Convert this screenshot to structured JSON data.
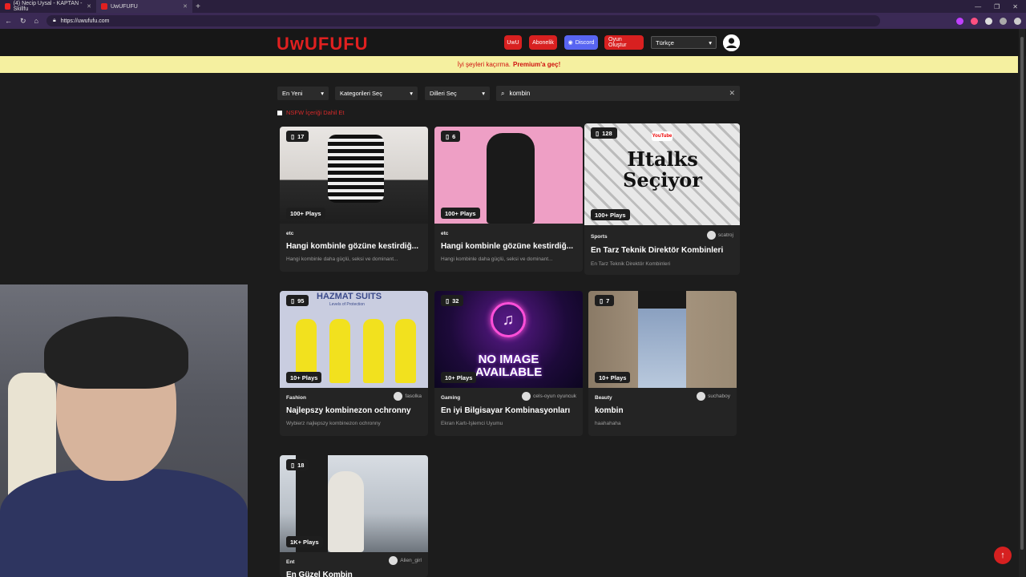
{
  "browser": {
    "tabs": [
      {
        "title": "(4) Necip Uysal - KAPTAN - Skillfu",
        "active": false
      },
      {
        "title": "UwUFUFU",
        "active": true
      }
    ],
    "url": "https://uwufufu.com"
  },
  "header": {
    "logo": "UwUFUFU",
    "buttons": [
      "UwU",
      "Abonelik",
      "Discord",
      "Oyun Oluştur"
    ],
    "language": "Türkçe"
  },
  "banner": {
    "text": "İyi şeyleri kaçırma.",
    "link": "Premium'a geç!"
  },
  "filters": {
    "sort": "En Yeni",
    "categories": "Kategorileri Seç",
    "languages": "Dilleri Seç",
    "search_value": "kombin",
    "nsfw_label": "NSFW İçeriği Dahil Et"
  },
  "cards": [
    {
      "count": "17",
      "plays": "100+ Plays",
      "category": "etc",
      "author": "",
      "title": "Hangi kombinle gözüne kestirdiğ...",
      "desc": "Hangi kombinle daha güçlü, seksi ve dominant..."
    },
    {
      "count": "6",
      "plays": "100+ Plays",
      "category": "etc",
      "author": "",
      "title": "Hangi kombinle gözüne kestirdiğ...",
      "desc": "Hangi kombinle daha güçlü, seksi ve dominant..."
    },
    {
      "count": "128",
      "plays": "100+ Plays",
      "category": "Sports",
      "author": "scatroj",
      "title": "En Tarz Teknik Direktör Kombinleri",
      "desc": "En Tarz Teknik Direktör Kombinleri",
      "thumb_text": "Htalks Seçiyor",
      "thumb_brand": "YouTube"
    },
    {
      "count": "95",
      "plays": "10+ Plays",
      "category": "Fashion",
      "author": "fasolka",
      "title": "Najlepszy kombinezon ochronny",
      "desc": "Wybierz najlepszy kombinezon ochronny",
      "thumb_text": "HAZMAT SUITS",
      "thumb_sub": "Levels of Protection"
    },
    {
      "count": "32",
      "plays": "10+ Plays",
      "category": "Gaming",
      "author": "cels-oyun oyuncuk",
      "title": "En iyi Bilgisayar Kombinasyonları",
      "desc": "Ekran Kartı-İşlemci Uyumu",
      "thumb_text": "NO IMAGE AVAILABLE"
    },
    {
      "count": "7",
      "plays": "10+ Plays",
      "category": "Beauty",
      "author": "suchaboy",
      "title": "kombin",
      "desc": "haahahaha"
    },
    {
      "count": "18",
      "plays": "1K+ Plays",
      "category": "Ent",
      "author": "Alien_girl",
      "title": "En Güzel Kombin",
      "desc": ""
    }
  ],
  "colors": {
    "brand": "#e02020",
    "discord": "#5865f2",
    "banner_bg": "#f5f0a0"
  }
}
